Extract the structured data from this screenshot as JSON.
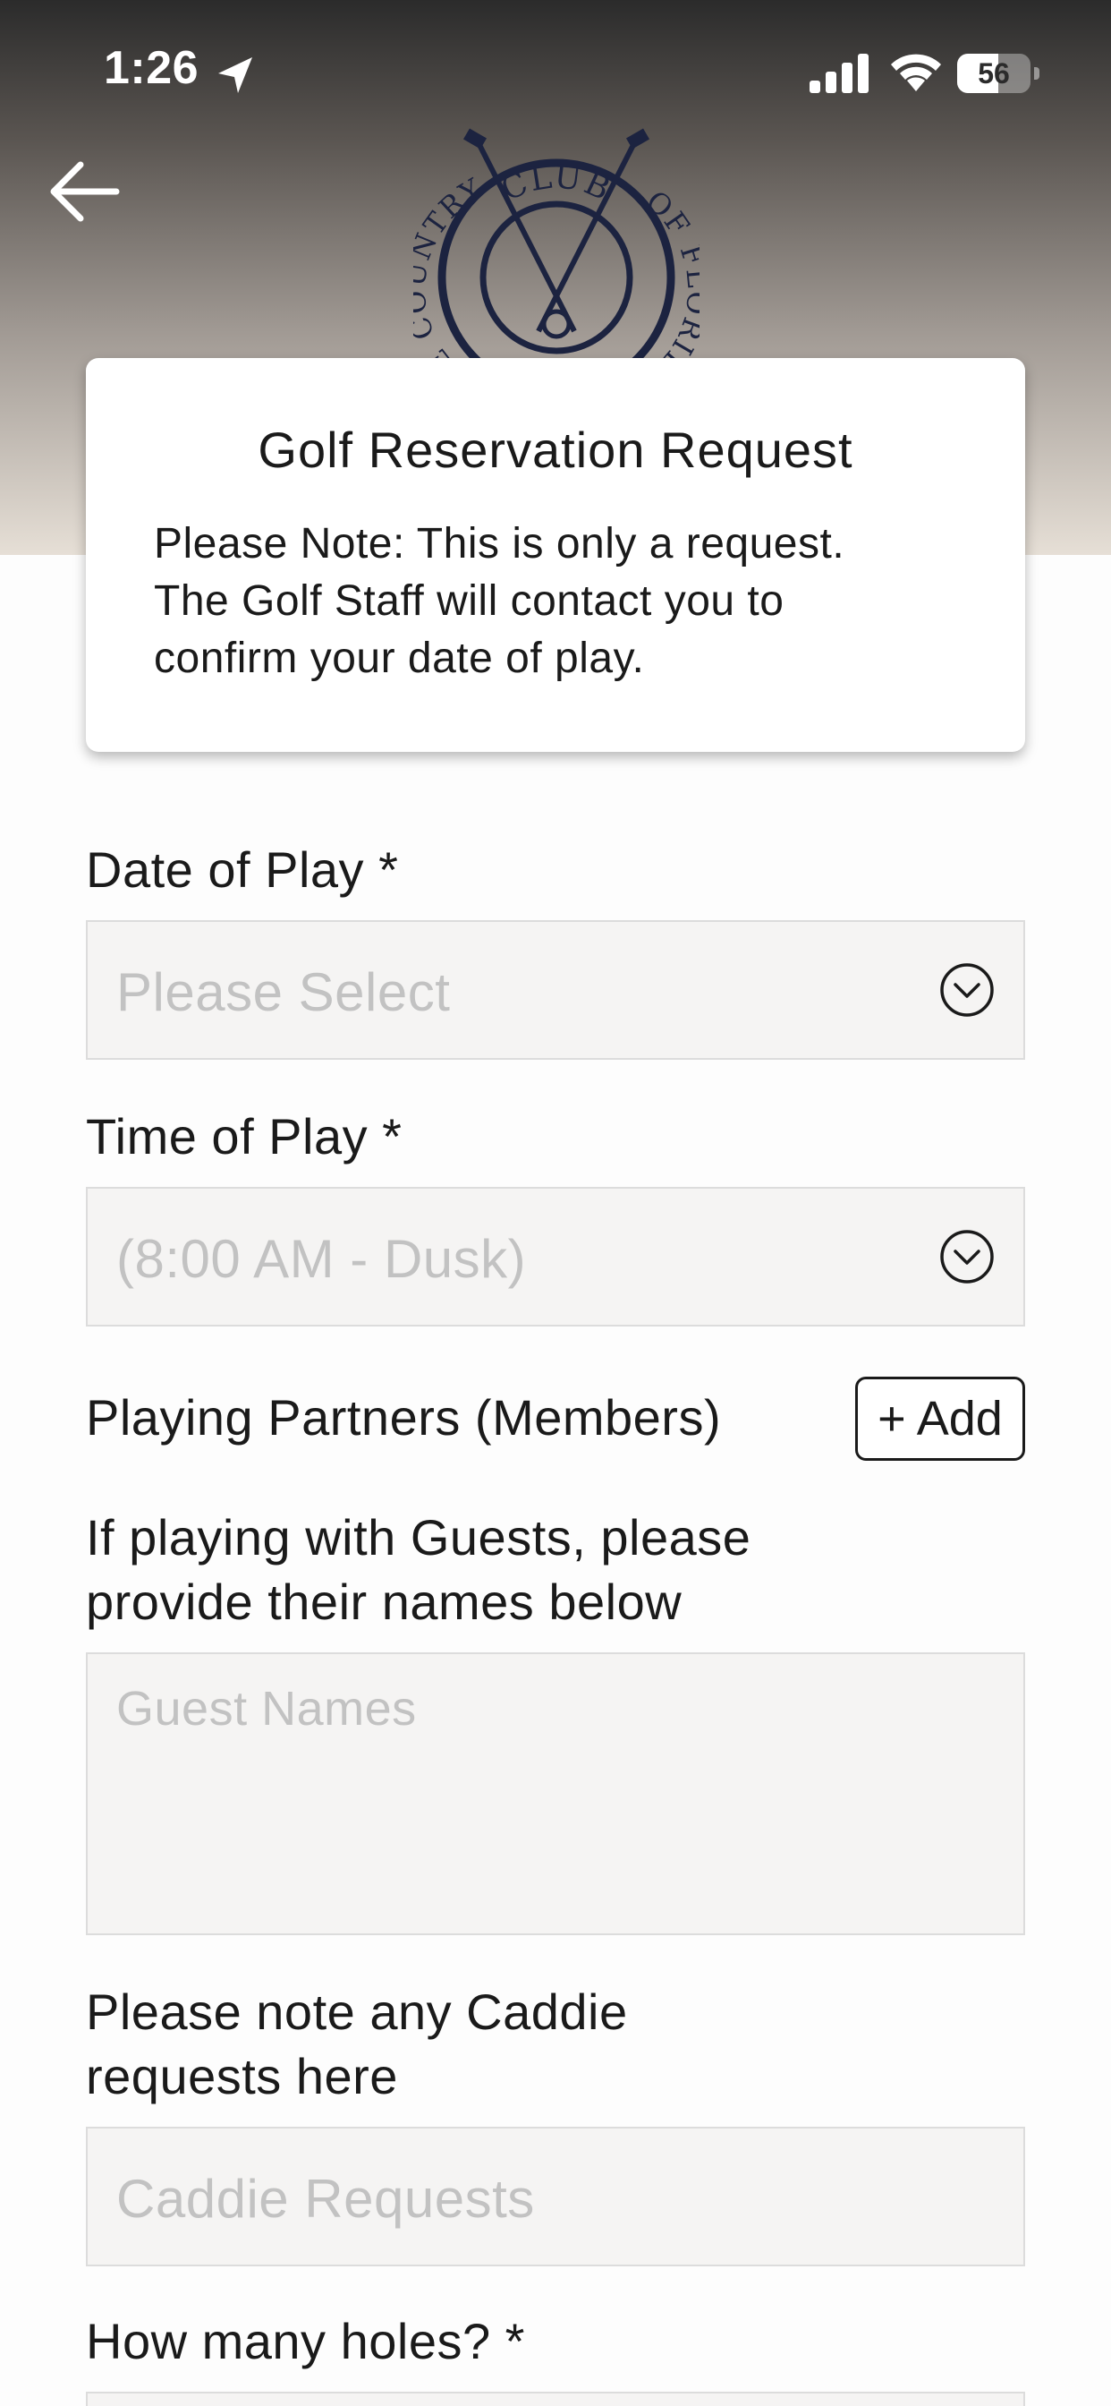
{
  "status_bar": {
    "time": "1:26",
    "battery_level": "56",
    "battery_fraction": 0.56
  },
  "header": {
    "logo_text_top": "CLUB",
    "logo_text_left": "THE COUNTRY",
    "logo_text_right": "OF FLORIDA"
  },
  "card": {
    "title": "Golf Reservation Request",
    "note_line1": "Please Note: This is only a request.",
    "note_line2": "The Golf Staff will contact you to",
    "note_line3": "confirm your date of play."
  },
  "form": {
    "date_label": "Date of Play *",
    "date_placeholder": "Please Select",
    "time_label": "Time of Play *",
    "time_placeholder": "(8:00 AM - Dusk)",
    "partners_label": "Playing Partners (Members)",
    "add_button_label": "+ Add",
    "guests_label_line1": "If playing with Guests, please",
    "guests_label_line2": "provide their names below",
    "guests_placeholder": "Guest Names",
    "caddie_label_line1": "Please note any Caddie",
    "caddie_label_line2": "requests here",
    "caddie_placeholder": "Caddie Requests",
    "holes_label": "How many holes? *"
  },
  "colors": {
    "text": "#1a1a1a",
    "placeholder": "#c2c2c2",
    "field_bg": "#f5f4f3",
    "logo_navy": "#1c2340"
  },
  "icons": {
    "back": "arrow-left-icon",
    "location": "location-arrow-icon",
    "signal": "cellular-signal-icon",
    "wifi": "wifi-icon",
    "battery": "battery-icon",
    "chevron": "chevron-down-circle-icon"
  }
}
